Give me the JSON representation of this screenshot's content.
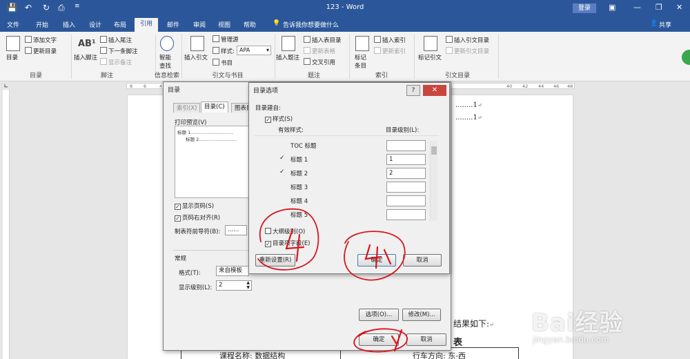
{
  "window": {
    "title": "123  -  Word",
    "login_label": "登录",
    "share_label": "共享"
  },
  "menu": {
    "tabs": [
      "文件",
      "开始",
      "插入",
      "设计",
      "布局",
      "引用",
      "邮件",
      "审阅",
      "视图",
      "帮助"
    ],
    "active_tab": "引用",
    "tellme": "告诉我你想要做什么"
  },
  "ribbon": {
    "toc_group": {
      "toc_label": "目录",
      "add_text": "添加文字",
      "update_toc": "更新目录",
      "group_label": "目录"
    },
    "footnote_group": {
      "insert_footnote": "插入脚注",
      "insert_endnote": "插入尾注",
      "next_footnote": "下一条脚注",
      "show_notes": "显示备注",
      "group_label": "脚注"
    },
    "research_group": {
      "smart_lookup": "智能查找",
      "group_label": "信息检索"
    },
    "citation_group": {
      "insert_citation": "插入引文",
      "manage_sources": "管理源",
      "style_label": "样式:",
      "style_value": "APA",
      "bibliography": "书目",
      "group_label": "引文与书目"
    },
    "caption_group": {
      "insert_caption": "插入题注",
      "insert_table_of_figures": "插入表目录",
      "update_table": "更新表格",
      "cross_reference": "交叉引用",
      "group_label": "题注"
    },
    "index_group": {
      "mark_entry": "标记条目",
      "insert_index": "插入索引",
      "update_index": "更新索引",
      "group_label": "索引"
    },
    "authorities_group": {
      "mark_citation": "标记引文",
      "insert_toa": "插入引文目录",
      "update_toa": "更新引文目录",
      "group_label": "引文目录"
    }
  },
  "ruler": {
    "ticks": [
      "8",
      "6",
      "4",
      "2",
      "40",
      "42",
      "44",
      "46",
      "48"
    ]
  },
  "document": {
    "toc_page_numbers": [
      "1",
      "1"
    ],
    "result_text": "结果如下:",
    "table_heading": "表",
    "table_row_left": "课程名称: 数据结构",
    "table_row_right": "行车方向: 东-西"
  },
  "toc_dialog": {
    "title": "目录",
    "tabs": [
      "索引(X)",
      "目录(C)",
      "图表目"
    ],
    "print_preview_label": "打印预览(V)",
    "preview_lines": [
      "标题 1..............................",
      "标题 2..........................."
    ],
    "show_page_numbers": "显示页码(S)",
    "right_align_page_numbers": "页码右对齐(R)",
    "tab_leader_label": "制表符前导符(B):",
    "tab_leader_value": "......",
    "general_label": "常规",
    "formats_label": "格式(T):",
    "formats_value": "来自模板",
    "show_levels_label": "显示级别(L):",
    "show_levels_value": "2",
    "options_button": "选项(O)...",
    "modify_button": "修改(M)...",
    "ok_button": "确定",
    "cancel_button": "取消"
  },
  "options_dialog": {
    "title": "目录选项",
    "build_from_label": "目录建自:",
    "styles_checkbox": "样式(S)",
    "available_styles_label": "有效样式:",
    "toc_level_label": "目录级别(L):",
    "styles": [
      {
        "name": "TOC 标题",
        "checked": false,
        "level": ""
      },
      {
        "name": "标题 1",
        "checked": true,
        "level": "1"
      },
      {
        "name": "标题 2",
        "checked": true,
        "level": "2"
      },
      {
        "name": "标题 3",
        "checked": false,
        "level": ""
      },
      {
        "name": "标题 4",
        "checked": false,
        "level": ""
      },
      {
        "name": "标题 5",
        "checked": false,
        "level": ""
      }
    ],
    "outline_levels_checkbox": "大纲级别(O)",
    "table_entry_fields_checkbox": "目录项字段(E)",
    "reset_button": "重新设置(R)",
    "ok_button": "确定",
    "cancel_button": "取消"
  },
  "annotations": {
    "color": "#d8141c",
    "label_1": "1",
    "label_2": "2"
  },
  "watermark": {
    "brand": "Bai经验",
    "site": "jingyan.baidu.com"
  },
  "colors": {
    "titlebar": "#2b579a",
    "close_button": "#c9463d",
    "annotation": "#d8141c"
  }
}
